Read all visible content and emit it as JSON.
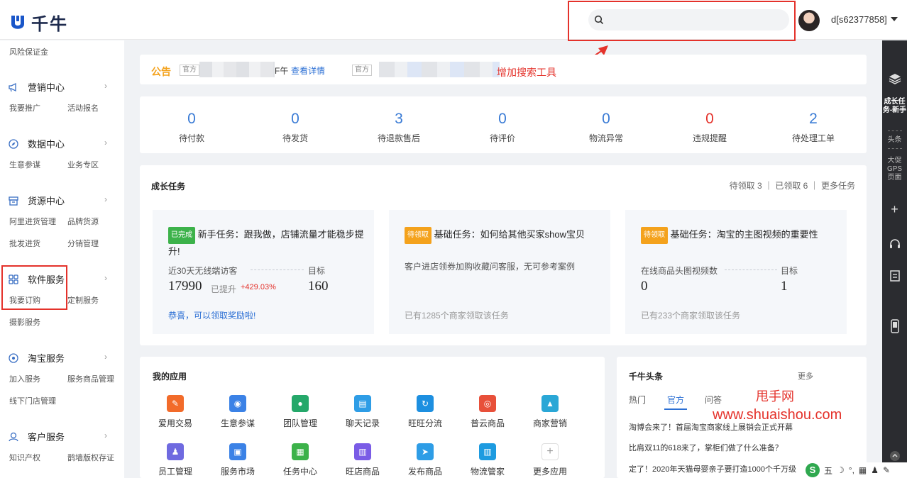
{
  "header": {
    "logo_text": "千牛",
    "search_placeholder": "",
    "username": "d[s62377858]"
  },
  "sidebar": {
    "top_item": "风险保证金",
    "sections": [
      {
        "title": "营销中心",
        "icon": "megaphone-icon",
        "items": [
          "我要推广",
          "活动报名"
        ]
      },
      {
        "title": "数据中心",
        "icon": "compass-icon",
        "items": [
          "生意参谋",
          "业务专区"
        ]
      },
      {
        "title": "货源中心",
        "icon": "box-icon",
        "items": [
          "阿里进货管理",
          "品牌货源",
          "批发进货",
          "分销管理"
        ]
      },
      {
        "title": "软件服务",
        "icon": "grid-icon",
        "items": [
          "我要订购",
          "定制服务",
          "摄影服务"
        ]
      },
      {
        "title": "淘宝服务",
        "icon": "taobao-icon",
        "items": [
          "加入服务",
          "服务商品管理",
          "线下门店管理"
        ]
      },
      {
        "title": "客户服务",
        "icon": "customer-icon",
        "items": [
          "知识产权",
          "鹊墙版权存证"
        ]
      }
    ]
  },
  "notice": {
    "label": "公告",
    "tag1": "官方",
    "tail1": "F午",
    "link": "查看详情",
    "tag2": "官方"
  },
  "annotation": "增加搜索工具",
  "stats": [
    {
      "value": "0",
      "label": "待付款"
    },
    {
      "value": "0",
      "label": "待发货"
    },
    {
      "value": "3",
      "label": "待退款售后"
    },
    {
      "value": "0",
      "label": "待评价"
    },
    {
      "value": "0",
      "label": "物流异常"
    },
    {
      "value": "0",
      "label": "违规提醒"
    },
    {
      "value": "2",
      "label": "待处理工单"
    }
  ],
  "growth": {
    "title": "成长任务",
    "meta": "待领取 3 ｜ 已领取 6 ｜ 更多任务",
    "tasks": [
      {
        "badge": "已完成",
        "badge_color": "#3cb24a",
        "title": "新手任务：跟我做，店铺流量才能稳步提升!",
        "metric": "近30天无线端访客",
        "target_label": "目标",
        "current": "17990",
        "raised_label": "已提升",
        "raised": "+429.03%",
        "target": "160",
        "footer": "恭喜，可以领取奖励啦!"
      },
      {
        "badge": "待领取",
        "badge_color": "#f4a21c",
        "title": "基础任务：如何给其他买家show宝贝",
        "desc": "客户进店领券加购收藏问客服，无可参考案例",
        "footer": "已有1285个商家领取该任务"
      },
      {
        "badge": "待领取",
        "badge_color": "#f4a21c",
        "title": "基础任务：淘宝的主图视频的重要性",
        "metric": "在线商品头图视频数",
        "target_label": "目标",
        "current": "0",
        "target": "1",
        "footer": "已有233个商家领取该任务"
      }
    ]
  },
  "apps": {
    "title": "我的应用",
    "items": [
      {
        "label": "爱用交易",
        "color": "#f26b2a",
        "icon": "trade-icon"
      },
      {
        "label": "生意参谋",
        "color": "#3b82e6",
        "icon": "compass-app-icon"
      },
      {
        "label": "团队管理",
        "color": "#25a86a",
        "icon": "team-icon"
      },
      {
        "label": "聊天记录",
        "color": "#2e9de6",
        "icon": "chat-record-icon"
      },
      {
        "label": "旺旺分流",
        "color": "#1d8fe0",
        "icon": "wangwang-icon"
      },
      {
        "label": "普云商品",
        "color": "#e8503a",
        "icon": "eye-icon"
      },
      {
        "label": "商家营销",
        "color": "#2aa7d6",
        "icon": "triangle-icon"
      },
      {
        "label": "员工管理",
        "color": "#6f6ae0",
        "icon": "staff-icon"
      },
      {
        "label": "服务市场",
        "color": "#3b82e6",
        "icon": "market-icon"
      },
      {
        "label": "任务中心",
        "color": "#3cb24a",
        "icon": "task-icon"
      },
      {
        "label": "旺店商品",
        "color": "#7a5ce6",
        "icon": "shop-icon"
      },
      {
        "label": "发布商品",
        "color": "#2e9de6",
        "icon": "send-icon"
      },
      {
        "label": "物流管家",
        "color": "#1d9be0",
        "icon": "logistics-icon"
      },
      {
        "label": "更多应用",
        "color": "#ffffff",
        "icon": "plus-icon"
      }
    ]
  },
  "news": {
    "title": "千牛头条",
    "more": "更多",
    "tabs": [
      "热门",
      "官方",
      "问答"
    ],
    "items": [
      "淘博会来了！首届淘宝商家线上展销会正式开幕",
      "比肩双11的618来了，掌柜们做了什么准备？",
      "定了！2020年天猫母婴亲子要打造1000个千万级"
    ]
  },
  "rail": {
    "items": [
      "成长任务-新手",
      "头条",
      "大促GPS页面"
    ]
  },
  "watermark": {
    "line1": "甩手网",
    "line2": "www.shuaishou.com"
  },
  "ime": {
    "logo": "S",
    "mode": "五"
  }
}
